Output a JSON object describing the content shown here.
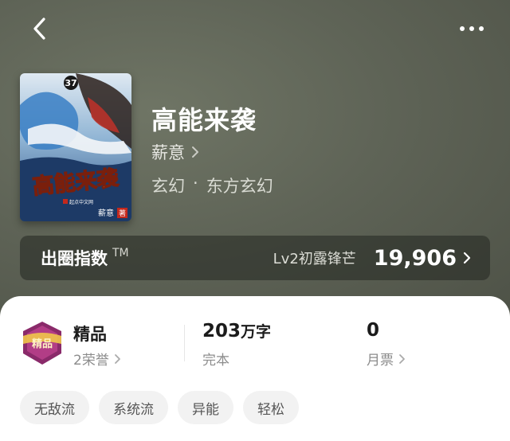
{
  "book": {
    "title": "高能来袭",
    "author": "薪意",
    "genre_primary": "玄幻",
    "genre_separator": "·",
    "genre_secondary": "东方玄幻",
    "cover": {
      "title_text": "高能来袭",
      "author_text": "薪意",
      "seal_text": "著",
      "number_text": "37",
      "publisher_text": "起点中文网"
    }
  },
  "index": {
    "label": "出圈指数",
    "tm": "TM",
    "level": "Lv2初露锋芒",
    "value": "19,906"
  },
  "stats": {
    "quality_title": "精品",
    "honors": "2荣誉",
    "badge_text": "精品",
    "word_count_number": "203",
    "word_count_unit": "万字",
    "status": "完本",
    "monthly_votes": "0",
    "monthly_votes_label": "月票"
  },
  "tags": [
    "无敌流",
    "系统流",
    "异能",
    "轻松"
  ],
  "colors": {
    "hero_bg": "#5f6457",
    "index_card_bg": "#2a2c26",
    "badge_purple": "#8a2a6a",
    "badge_gold": "#f0c64a",
    "tag_bg": "#f2f2f2"
  },
  "icons": {
    "back": "chevron-left-icon",
    "more": "more-horizontal-icon",
    "author_arrow": "chevron-right-icon",
    "index_arrow": "chevron-right-icon"
  }
}
